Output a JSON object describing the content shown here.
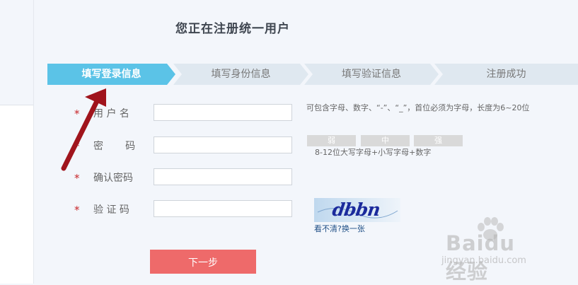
{
  "page": {
    "title": "您正在注册统一用户"
  },
  "steps": [
    {
      "label": "填写登录信息",
      "active": true
    },
    {
      "label": "填写身份信息",
      "active": false
    },
    {
      "label": "填写验证信息",
      "active": false
    },
    {
      "label": "注册成功",
      "active": false
    }
  ],
  "form": {
    "required_mark": "*",
    "username_label": "用 户 名",
    "password_label": "密       码",
    "confirm_label": "确认密码",
    "captcha_label": "验 证 码",
    "username_value": "",
    "password_value": "",
    "confirm_value": "",
    "captcha_value": ""
  },
  "hints": {
    "username": "可包含字母、数字、“-”、“_”，首位必须为字母，长度为6~20位",
    "password": "8-12位大写字母+小写字母+数字",
    "strength": [
      "弱",
      "中",
      "强"
    ]
  },
  "captcha": {
    "image_text": "dbbn",
    "refresh_link": "看不清?换一张"
  },
  "next_button": "下一步",
  "watermark": {
    "main": "Baidu经验",
    "url": "jingyan.baidu.com"
  },
  "colors": {
    "step_active": "#5bc3e7",
    "step_inactive": "#dfe8f0",
    "button": "#ee6a6a",
    "required": "#c8262a",
    "annotation_arrow": "#a0141c"
  }
}
